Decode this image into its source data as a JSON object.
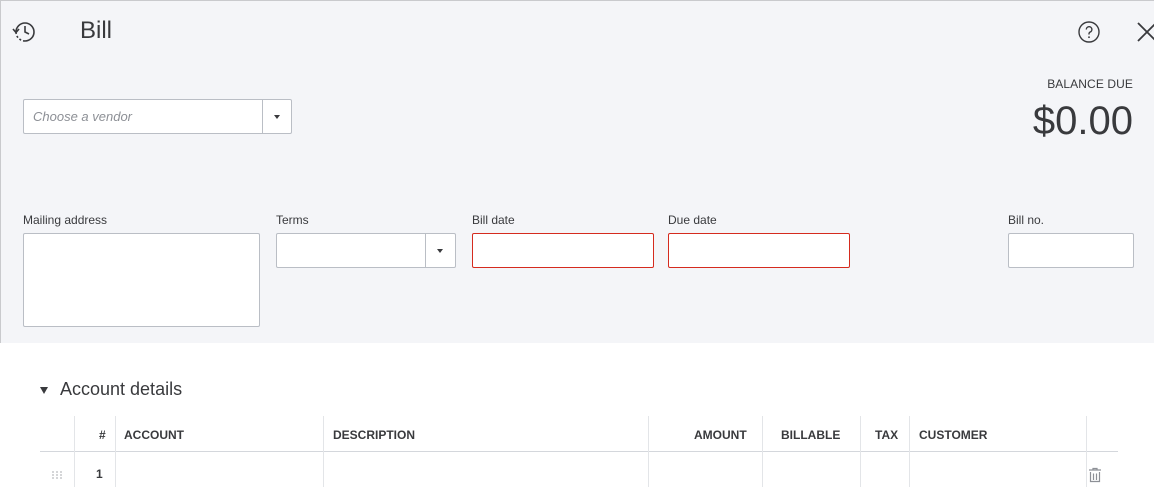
{
  "header": {
    "title": "Bill",
    "history_icon": "history-icon",
    "help_icon": "help-icon",
    "close_icon": "close-icon"
  },
  "balance": {
    "label": "BALANCE DUE",
    "amount": "$0.00"
  },
  "vendor": {
    "placeholder": "Choose a vendor",
    "value": ""
  },
  "fields": {
    "mailing_address": {
      "label": "Mailing address",
      "value": ""
    },
    "terms": {
      "label": "Terms",
      "value": ""
    },
    "bill_date": {
      "label": "Bill date",
      "value": ""
    },
    "due_date": {
      "label": "Due date",
      "value": ""
    },
    "bill_no": {
      "label": "Bill no.",
      "value": ""
    }
  },
  "account_details": {
    "title": "Account details",
    "columns": [
      "#",
      "ACCOUNT",
      "DESCRIPTION",
      "AMOUNT",
      "BILLABLE",
      "TAX",
      "CUSTOMER"
    ],
    "rows": [
      {
        "num": "1",
        "account": "",
        "description": "",
        "amount": "",
        "billable": "",
        "tax": "",
        "customer": ""
      }
    ]
  },
  "colors": {
    "panel_bg": "#f4f5f8",
    "text": "#393a3d",
    "border": "#babec5",
    "error_border": "#d52b1e"
  }
}
